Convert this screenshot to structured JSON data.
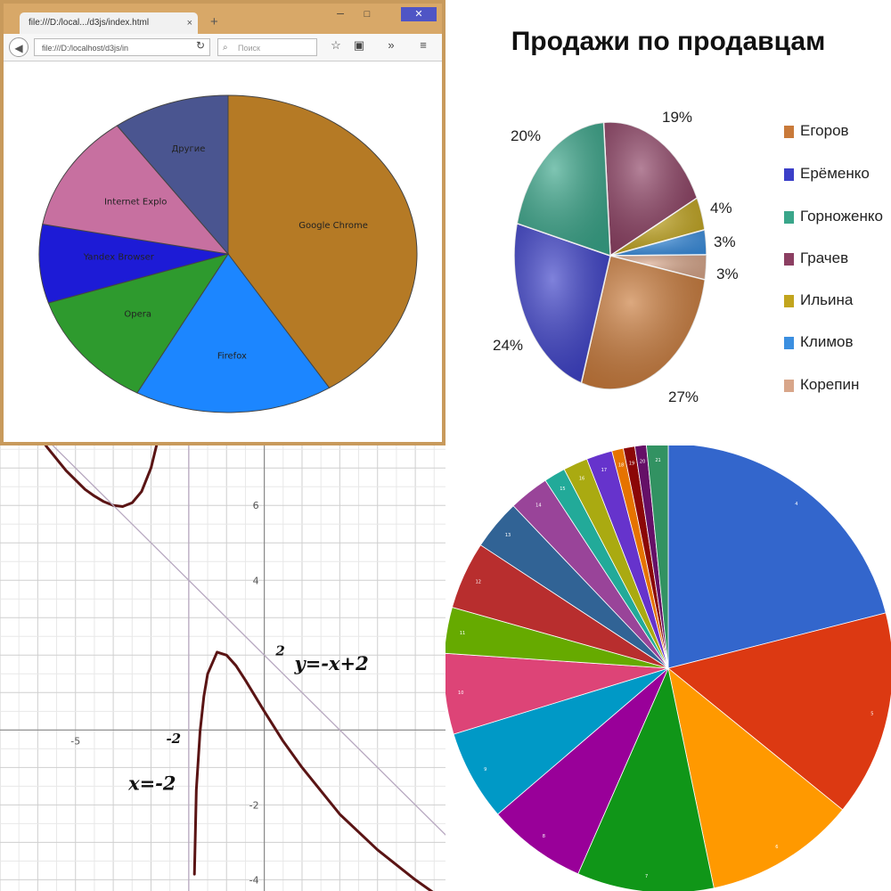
{
  "browser": {
    "tab_title": "file:///D:/local.../d3js/index.html",
    "tab_close": "×",
    "new_tab": "+",
    "window_minimize": "─",
    "window_maximize": "□",
    "window_close": "✕",
    "url": "file:///D:/localhost/d3js/in",
    "search_placeholder": "Поиск",
    "back_icon": "arrow-left-icon",
    "reload_icon": "reload-icon",
    "search_icon": "search-icon",
    "star_icon": "star-icon",
    "overflow_icon": "double-chevron-icon",
    "menu_icon": "hamburger-menu-icon"
  },
  "chart_data": [
    {
      "type": "pie",
      "labels": [
        "Google Chrome",
        "Firefox",
        "Opera",
        "Yandex Browser",
        "Internet Explo",
        "Другие"
      ],
      "values": [
        41,
        17,
        12,
        8,
        12,
        10
      ],
      "colors": [
        "#b57a25",
        "#1c86ff",
        "#2e9a2e",
        "#1d1bd6",
        "#c770a0",
        "#4a5590"
      ],
      "start_angle_deg": 0,
      "direction": "clockwise"
    },
    {
      "type": "pie",
      "title": "Продажи по продавцам",
      "labels": [
        "Егоров",
        "Ерёменко",
        "Горноженко",
        "Грачев",
        "Ильина",
        "Климов",
        "Корепин"
      ],
      "values": [
        27,
        24,
        20,
        19,
        4,
        3,
        3
      ],
      "percent_labels": [
        "27%",
        "24%",
        "20%",
        "19%",
        "4%",
        "3%",
        "3%"
      ],
      "colors": [
        "#c97a3a",
        "#3b3fc8",
        "#3aa68a",
        "#8c3f62",
        "#c2a51e",
        "#3b8fe0",
        "#d8a68a"
      ],
      "legend": "right"
    },
    {
      "type": "line",
      "series": [
        {
          "name": "",
          "x": [
            -6.65,
            -6.25,
            -5.75,
            -5.25,
            -4.75,
            -4.5,
            -4.25,
            -4,
            -3.75,
            -3.5,
            -3.25,
            -3,
            -2.85,
            -2.75,
            -2.65,
            -2.56
          ],
          "y": [
            8.94,
            8.25,
            7.55,
            6.93,
            6.43,
            6.25,
            6.1,
            6.0,
            5.97,
            6.07,
            6.37,
            7.0,
            7.62,
            8.08,
            8.73,
            9.4
          ]
        },
        {
          "name": "",
          "x": [
            -1.85,
            -1.8,
            -1.7,
            -1.6,
            -1.5,
            -1.25,
            -1,
            -0.75,
            -0.5,
            0,
            0.5,
            1,
            2,
            3,
            4,
            4.7
          ],
          "y": [
            -3.85,
            -1.6,
            -0.03,
            0.9,
            1.5,
            2.08,
            2.0,
            1.72,
            1.33,
            0.5,
            -0.3,
            -1.0,
            -2.25,
            -3.2,
            -4.0,
            -4.5
          ]
        },
        {
          "name": "",
          "x": [
            -7,
            5
          ],
          "y": [
            9,
            -3
          ]
        },
        {
          "name": "",
          "x": [
            -2,
            -2
          ],
          "y": [
            -4.3,
            7.6
          ]
        }
      ],
      "annotations": [
        "y=-x+2",
        "x=-2",
        "-2",
        "2"
      ],
      "xticks": [
        "-5"
      ],
      "yticks": [
        "6",
        "4",
        "-2",
        "-4"
      ],
      "xlim": [
        -7,
        4.8
      ],
      "ylim": [
        -4.3,
        7.6
      ],
      "grid": true,
      "colors": {
        "curve": "#5a1414",
        "asymptote": "#b7a8c0"
      }
    },
    {
      "type": "pie",
      "labels": [
        "4",
        "5",
        "6",
        "7",
        "8",
        "9",
        "10",
        "11",
        "12",
        "13",
        "14",
        "15",
        "16",
        "17",
        "18",
        "19",
        "20",
        "21"
      ],
      "values": [
        20.3,
        14.3,
        10.5,
        9.5,
        6.9,
        6.3,
        5.6,
        3.2,
        4.7,
        3.5,
        2.8,
        1.5,
        1.7,
        1.8,
        0.8,
        0.8,
        0.8,
        1.5
      ],
      "colors": [
        "#3366cc",
        "#dc3912",
        "#ff9900",
        "#109618",
        "#990099",
        "#0099c6",
        "#dd4477",
        "#66aa00",
        "#b82e2e",
        "#316395",
        "#994499",
        "#22aa99",
        "#aaaa11",
        "#6633cc",
        "#e67300",
        "#8b0707",
        "#651067",
        "#329262"
      ],
      "start_angle_deg": 0,
      "direction": "clockwise"
    }
  ]
}
